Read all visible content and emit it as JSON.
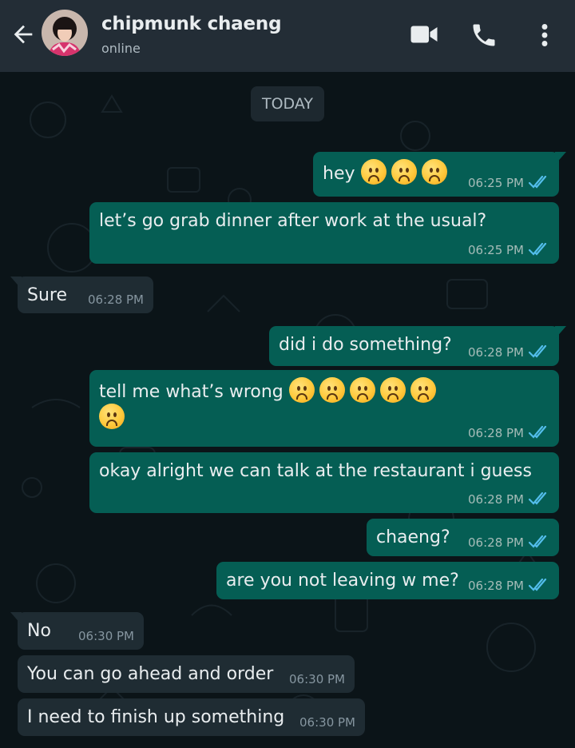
{
  "header": {
    "contact_name": "chipmunk chaeng",
    "status": "online",
    "icons": [
      "back-arrow-icon",
      "avatar",
      "video-call-icon",
      "phone-icon",
      "more-options-icon"
    ]
  },
  "chat": {
    "date_label": "TODAY",
    "messages": [
      {
        "dir": "out",
        "text": "hey",
        "emojis": 3,
        "time": "06:25 PM",
        "read": true
      },
      {
        "dir": "out",
        "text": "let’s go grab dinner after work at the usual?",
        "emojis": 0,
        "time": "06:25 PM",
        "read": true
      },
      {
        "dir": "in",
        "text": "Sure",
        "emojis": 0,
        "time": "06:28 PM"
      },
      {
        "dir": "out",
        "text": "did i do something?",
        "emojis": 0,
        "time": "06:28 PM",
        "read": true
      },
      {
        "dir": "out",
        "text": "tell me what’s wrong",
        "emojis": 6,
        "time": "06:28 PM",
        "read": true
      },
      {
        "dir": "out",
        "text": "okay alright we can talk at the restaurant i guess",
        "emojis": 0,
        "time": "06:28 PM",
        "read": true
      },
      {
        "dir": "out",
        "text": "chaeng?",
        "emojis": 0,
        "time": "06:28 PM",
        "read": true
      },
      {
        "dir": "out",
        "text": "are you not leaving w me?",
        "emojis": 0,
        "time": "06:28 PM",
        "read": true
      },
      {
        "dir": "in",
        "text": "No",
        "emojis": 0,
        "time": "06:30 PM"
      },
      {
        "dir": "in",
        "text": "You can go ahead and order",
        "emojis": 0,
        "time": "06:30 PM"
      },
      {
        "dir": "in",
        "text": "I need to finish up something",
        "emojis": 0,
        "time": "06:30 PM"
      }
    ]
  },
  "colors": {
    "header_bg": "#232d36",
    "chat_bg": "#0b1418",
    "outgoing_bubble": "#055e54",
    "incoming_bubble": "#1f2c33",
    "read_tick": "#53bdeb",
    "text": "#e9edef"
  }
}
